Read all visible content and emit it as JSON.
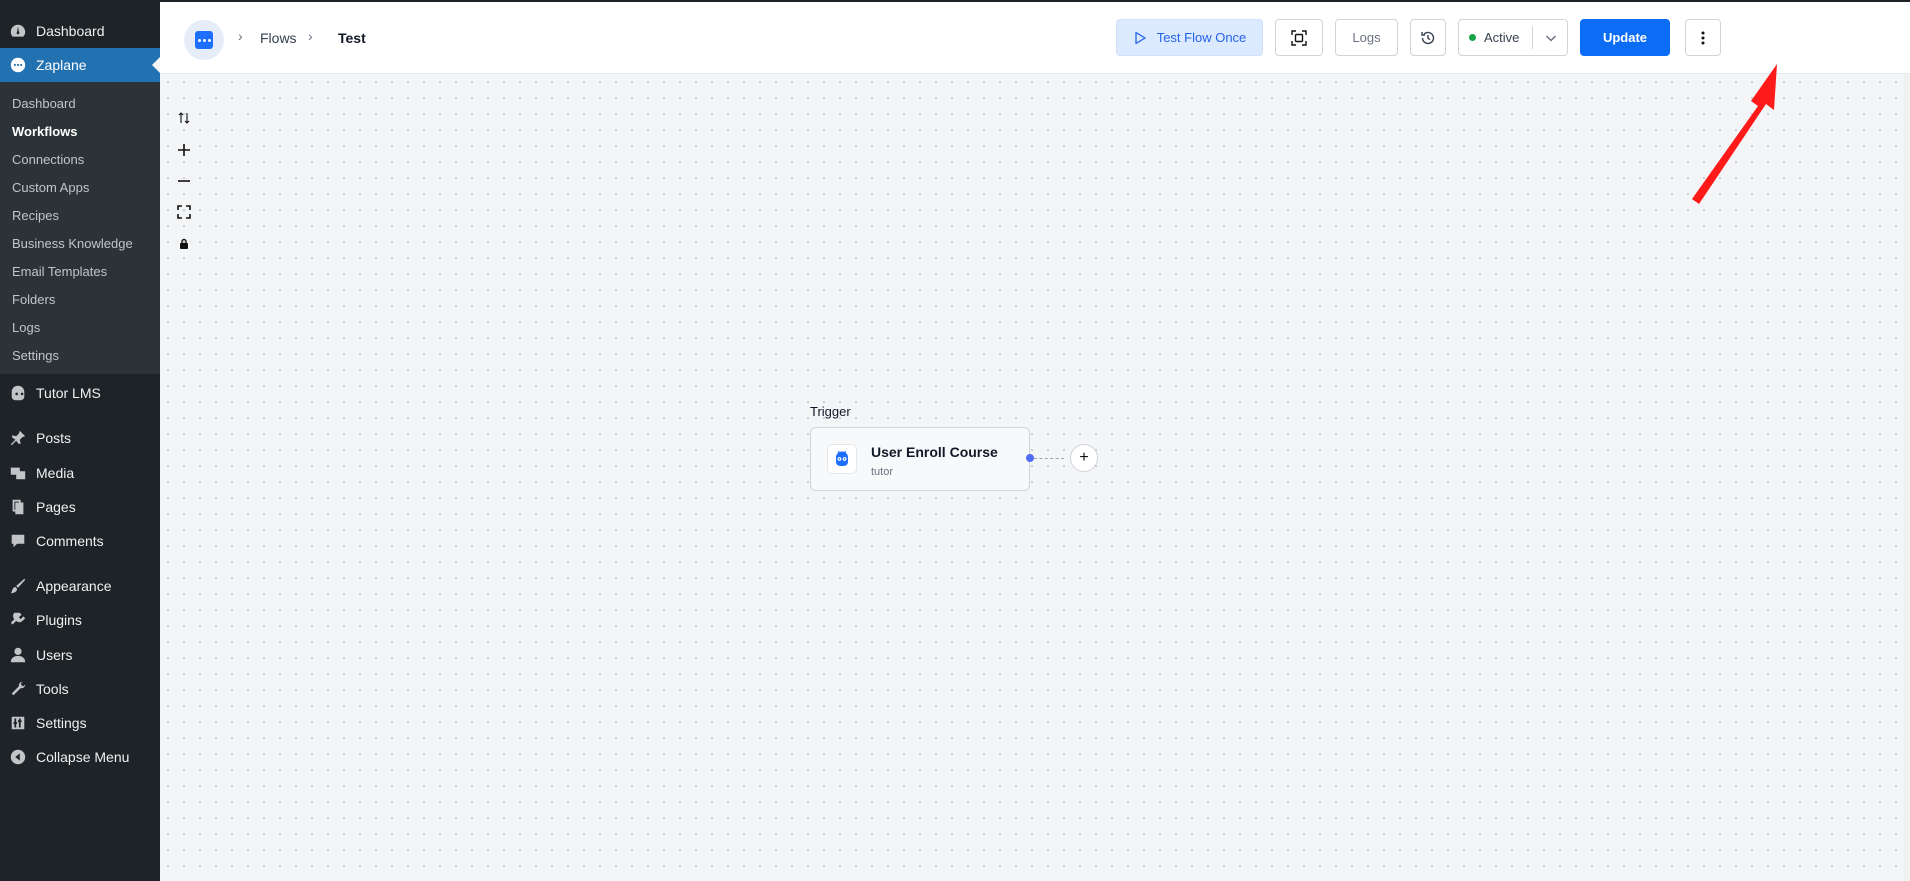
{
  "wp_menu": {
    "top_items": [
      {
        "label": "Dashboard",
        "icon": "dashboard-icon"
      },
      {
        "label": "Zaplane",
        "icon": "zaplane-icon"
      }
    ],
    "zaplane_submenu": [
      "Dashboard",
      "Workflows",
      "Connections",
      "Custom Apps",
      "Recipes",
      "Business Knowledge",
      "Email Templates",
      "Folders",
      "Logs",
      "Settings"
    ],
    "items": [
      {
        "label": "Tutor LMS",
        "icon": "tutor-icon"
      },
      {
        "label": "Posts",
        "icon": "pin-icon"
      },
      {
        "label": "Media",
        "icon": "media-icon"
      },
      {
        "label": "Pages",
        "icon": "pages-icon"
      },
      {
        "label": "Comments",
        "icon": "comment-icon"
      },
      {
        "label": "Appearance",
        "icon": "brush-icon"
      },
      {
        "label": "Plugins",
        "icon": "plugin-icon"
      },
      {
        "label": "Users",
        "icon": "user-icon"
      },
      {
        "label": "Tools",
        "icon": "wrench-icon"
      },
      {
        "label": "Settings",
        "icon": "sliders-icon"
      },
      {
        "label": "Collapse Menu",
        "icon": "collapse-icon"
      }
    ]
  },
  "breadcrumb": {
    "flows": "Flows",
    "current": "Test"
  },
  "toolbar": {
    "test_flow": "Test Flow Once",
    "logs": "Logs",
    "status": "Active",
    "update": "Update"
  },
  "canvas": {
    "trigger_label": "Trigger",
    "node": {
      "title": "User Enroll Course",
      "subtitle": "tutor"
    }
  },
  "colors": {
    "primary": "#0b6cf5",
    "wp_sidebar": "#1d2327",
    "wp_active": "#2271b1",
    "status_dot": "#16a34a",
    "annotation_arrow": "#ff1a1a"
  }
}
